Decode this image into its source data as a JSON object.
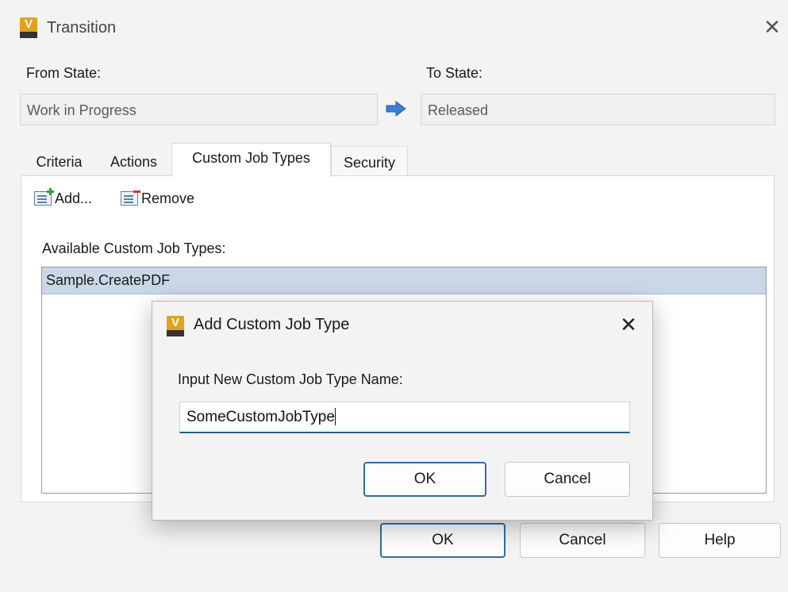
{
  "window": {
    "title": "Transition",
    "close_glyph": "✕",
    "icon": "vault-app-icon"
  },
  "from_state": {
    "label": "From State:",
    "value": "Work in Progress"
  },
  "to_state": {
    "label": "To State:",
    "value": "Released"
  },
  "tabs": [
    {
      "label": "Criteria",
      "active": false
    },
    {
      "label": "Actions",
      "active": false
    },
    {
      "label": "Custom Job Types",
      "active": true
    },
    {
      "label": "Security",
      "active": false
    }
  ],
  "toolbar": {
    "add_label": "Add...",
    "remove_label": "Remove"
  },
  "list": {
    "label": "Available Custom Job Types:",
    "items": [
      "Sample.CreatePDF"
    ]
  },
  "footer": {
    "ok_label": "OK",
    "cancel_label": "Cancel",
    "help_label": "Help"
  },
  "dialog": {
    "title": "Add Custom Job Type",
    "close_glyph": "✕",
    "prompt": "Input New Custom Job Type Name:",
    "input_value": "SomeCustomJobType",
    "ok_label": "OK",
    "cancel_label": "Cancel"
  },
  "colors": {
    "accent": "#2d6ea8",
    "selection": "#c9d7e6",
    "arrow": "#3b7fd9",
    "app_icon": "#e3a21a"
  }
}
